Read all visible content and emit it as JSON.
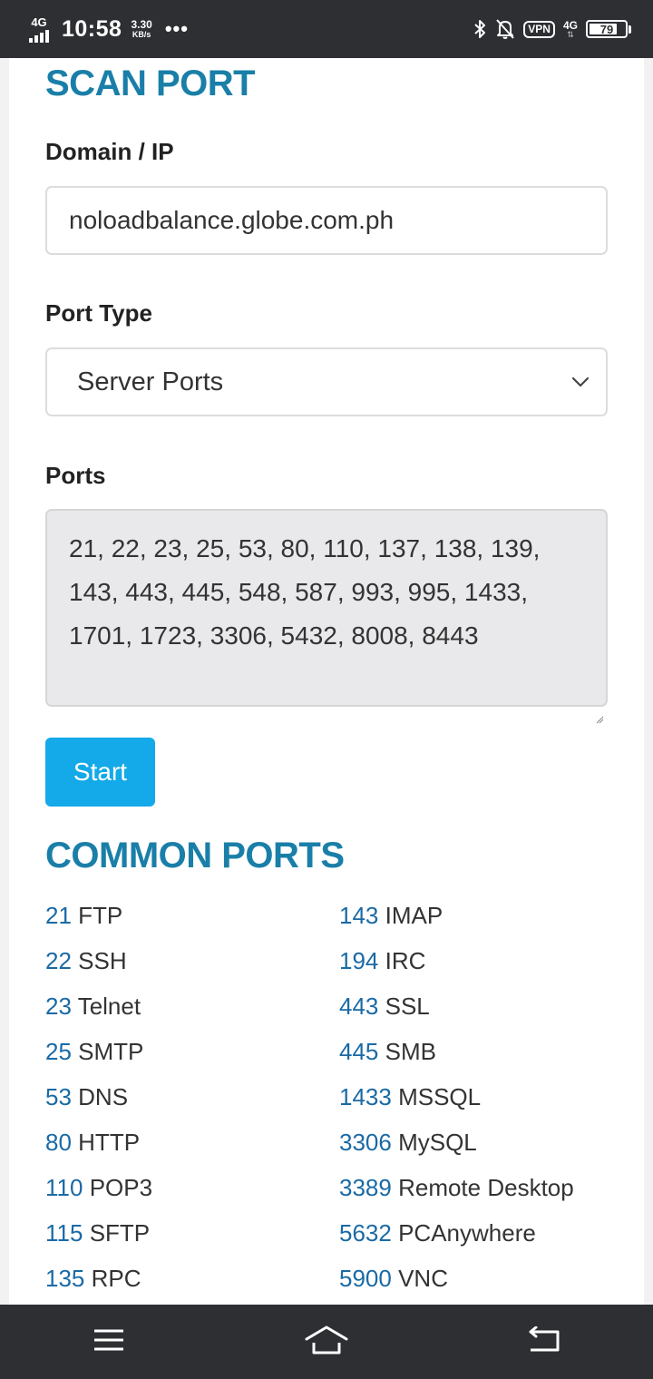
{
  "status_bar": {
    "network_label": "4G",
    "time": "10:58",
    "speed_value": "3.30",
    "speed_unit": "KB/s",
    "more": "•••",
    "vpn_label": "VPN",
    "lte_label": "4G",
    "battery_level": "79"
  },
  "scan_port": {
    "title": "SCAN PORT",
    "domain_label": "Domain / IP",
    "domain_value": "noloadbalance.globe.com.ph",
    "port_type_label": "Port Type",
    "port_type_selected": "Server Ports",
    "ports_label": "Ports",
    "ports_value": "21, 22, 23, 25, 53, 80, 110, 137, 138, 139, 143, 443, 445, 548, 587, 993, 995, 1433, 1701, 1723, 3306, 5432, 8008, 8443",
    "start_label": "Start"
  },
  "common_ports": {
    "title": "COMMON PORTS",
    "left": [
      {
        "port": "21",
        "name": "FTP"
      },
      {
        "port": "22",
        "name": "SSH"
      },
      {
        "port": "23",
        "name": "Telnet"
      },
      {
        "port": "25",
        "name": "SMTP"
      },
      {
        "port": "53",
        "name": "DNS"
      },
      {
        "port": "80",
        "name": "HTTP"
      },
      {
        "port": "110",
        "name": "POP3"
      },
      {
        "port": "115",
        "name": "SFTP"
      },
      {
        "port": "135",
        "name": "RPC"
      }
    ],
    "right": [
      {
        "port": "143",
        "name": "IMAP"
      },
      {
        "port": "194",
        "name": "IRC"
      },
      {
        "port": "443",
        "name": "SSL"
      },
      {
        "port": "445",
        "name": "SMB"
      },
      {
        "port": "1433",
        "name": "MSSQL"
      },
      {
        "port": "3306",
        "name": "MySQL"
      },
      {
        "port": "3389",
        "name": "Remote Desktop"
      },
      {
        "port": "5632",
        "name": "PCAnywhere"
      },
      {
        "port": "5900",
        "name": "VNC"
      }
    ]
  },
  "colors": {
    "heading": "#1a7fa8",
    "port_number": "#1a6aa5",
    "button": "#14a9e8",
    "system_bar": "#2e2f33"
  },
  "icons": {
    "status": [
      "signal-bars-icon",
      "bluetooth-icon",
      "notifications-off-icon",
      "battery-icon"
    ],
    "navigation": [
      "menu-icon",
      "home-icon",
      "back-icon"
    ]
  }
}
